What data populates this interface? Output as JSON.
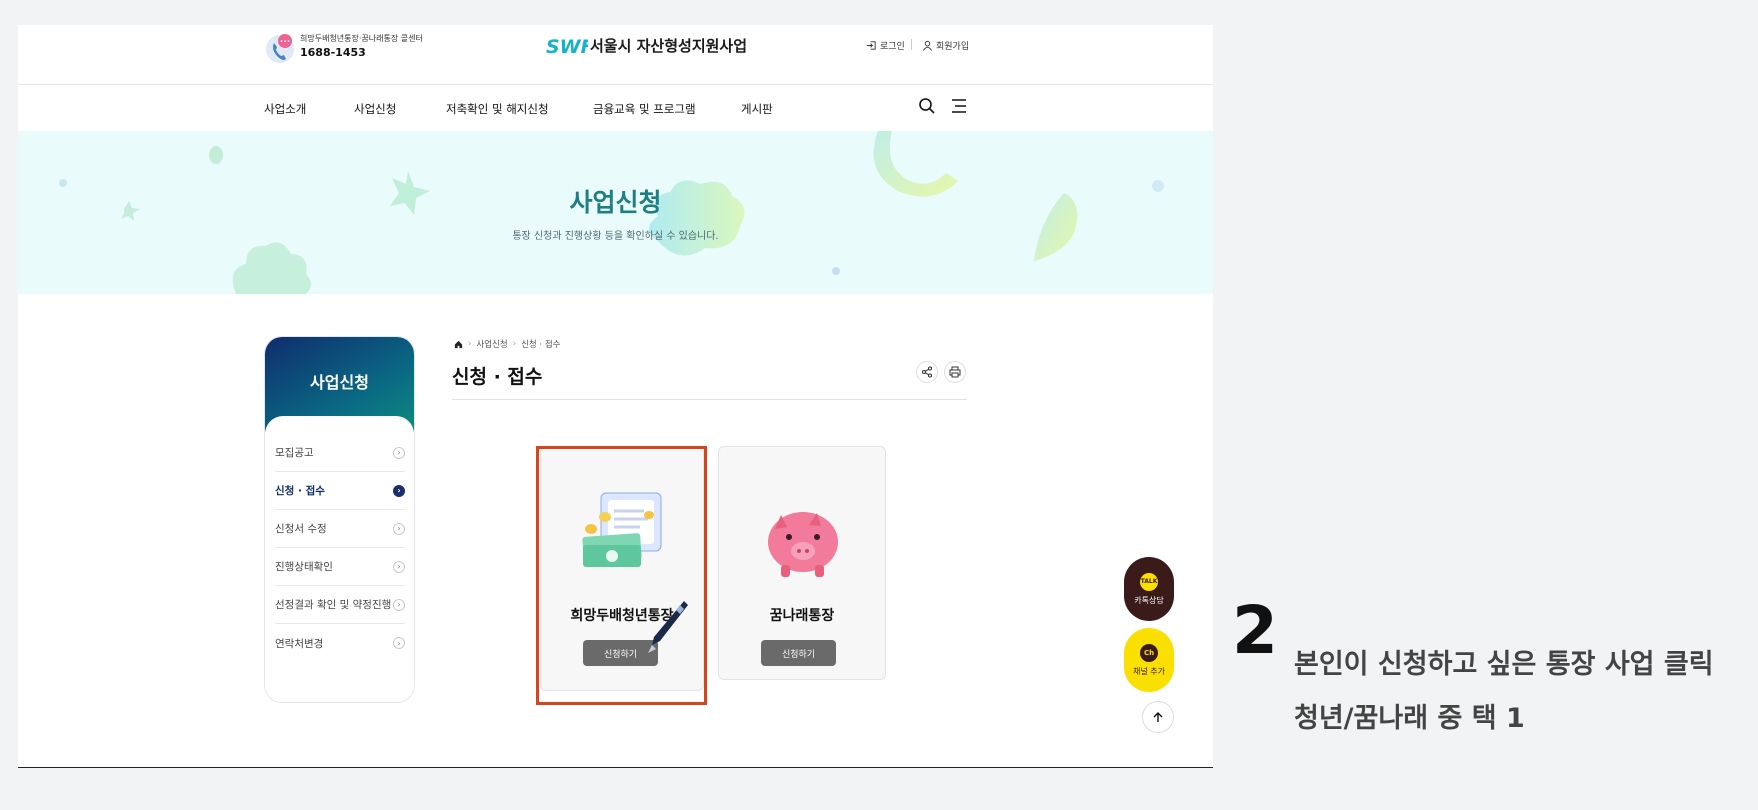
{
  "header": {
    "callcenter_label": "희망두배청년통장·꿈나래통장 콜센터",
    "callcenter_phone": "1688-1453",
    "logo_mark": "SWF",
    "logo_text": "서울시 자산형성지원사업",
    "login_label": "로그인",
    "join_label": "회원가입"
  },
  "gnb": {
    "items": [
      {
        "label": "사업소개"
      },
      {
        "label": "사업신청"
      },
      {
        "label": "저축확인 및 해지신청"
      },
      {
        "label": "금융교육 및 프로그램"
      },
      {
        "label": "게시판"
      }
    ],
    "search_icon": "search-icon",
    "menu_icon": "menu-icon"
  },
  "banner": {
    "title": "사업신청",
    "subtitle": "통장 신청과 진행상황 등을 확인하실 수 있습니다."
  },
  "lnb": {
    "title": "사업신청",
    "items": [
      {
        "label": "모집공고",
        "active": false
      },
      {
        "label": "신청 · 접수",
        "active": true
      },
      {
        "label": "신청서 수정",
        "active": false
      },
      {
        "label": "진행상태확인",
        "active": false
      },
      {
        "label": "선정결과 확인 및 약정진행",
        "active": false
      },
      {
        "label": "연락처변경",
        "active": false
      }
    ]
  },
  "content": {
    "breadcrumb": [
      "사업신청",
      "신청 · 접수"
    ],
    "title": "신청 · 접수",
    "cards": [
      {
        "name": "희망두배청년통장",
        "button": "신청하기",
        "highlighted": true
      },
      {
        "name": "꿈나래통장",
        "button": "신청하기",
        "highlighted": false
      }
    ]
  },
  "floating": {
    "talk_badge": "TALK",
    "talk_label": "카톡상담",
    "channel_badge": "Ch",
    "channel_label": "채널 추가",
    "top_icon": "arrow-up-icon"
  },
  "instruction": {
    "step": "2",
    "line1": "본인이 신청하고 싶은 통장 사업 클릭",
    "line2": "청년/꿈나래 중 택 1"
  },
  "colors": {
    "accent_teal": "#1f7e83",
    "highlight": "#d6461e",
    "lnb_active": "#1b2f6e",
    "kakao_yellow": "#f9e000"
  }
}
